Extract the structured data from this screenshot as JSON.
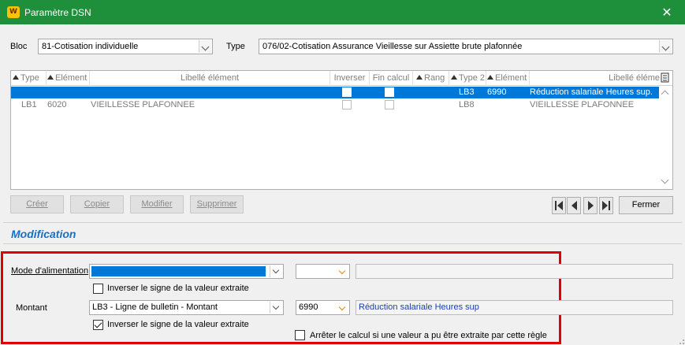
{
  "window": {
    "app_icon": "W",
    "title": "Paramètre DSN",
    "close_icon": "✕"
  },
  "filters": {
    "bloc_label": "Bloc",
    "bloc_value": "81-Cotisation individuelle",
    "type_label": "Type",
    "type_value": "076/02-Cotisation Assurance Vieillesse sur Assiette  brute plafonnée"
  },
  "grid": {
    "columns": [
      "Type",
      "Elément",
      "Libellé élément",
      "Inverser",
      "Fin calcul",
      "Rang",
      "Type 2",
      "Elément 2",
      "Libellé éléme"
    ],
    "rows": [
      {
        "type": "",
        "element": "",
        "libelle": "",
        "inverser": false,
        "fin_calcul": false,
        "rang": "",
        "type2": "LB3",
        "element2": "6990",
        "libelle2": "Réduction salariale Heures sup.",
        "selected": true
      },
      {
        "type": "LB1",
        "element": "6020",
        "libelle": "VIEILLESSE PLAFONNEE",
        "inverser": false,
        "fin_calcul": false,
        "rang": "",
        "type2": "LB8",
        "element2": "",
        "libelle2": "VIEILLESSE PLAFONNEE",
        "selected": false
      }
    ]
  },
  "actions": {
    "creer": "Créer",
    "copier": "Copier",
    "modifier": "Modifier",
    "supprimer": "Supprimer",
    "fermer": "Fermer"
  },
  "modification": {
    "title": "Modification",
    "mode_label": "Mode d'alimentation",
    "mode_value": "",
    "inverser_label_1": "Inverser le signe de la valeur extraite",
    "inverser_checked_1": false,
    "montant_label": "Montant",
    "montant_value": "LB3 - Ligne de bulletin - Montant",
    "montant_code": "6990",
    "montant_libelle": "Réduction salariale Heures sup",
    "inverser_label_2": "Inverser le signe de la valeur extraite",
    "inverser_checked_2": true,
    "arreter_label": "Arrêter le calcul si une valeur a pu être extraite par cette règle",
    "arreter_checked": false
  },
  "colors": {
    "titlebar": "#1e8f3a",
    "selection": "#0078d7",
    "section_title": "#1a6fc0",
    "highlight_box": "#e00000"
  }
}
